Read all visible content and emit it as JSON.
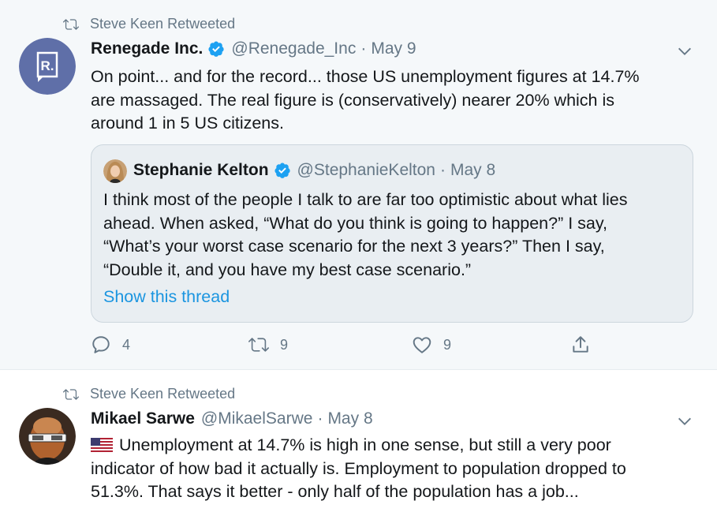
{
  "tweet1": {
    "retweet_by": "Steve Keen Retweeted",
    "author_name": "Renegade Inc.",
    "author_handle": "@Renegade_Inc",
    "date": "May 9",
    "dot": "·",
    "avatar_letter": "R.",
    "text_lines": [
      "On point... and for the record... those US unemployment figures at 14.7%",
      "are massaged. The real figure is (conservatively) nearer 20% which is",
      "around 1 in 5 US citizens."
    ],
    "quote": {
      "author_name": "Stephanie Kelton",
      "author_handle": "@StephanieKelton",
      "date": "May 8",
      "text_lines": [
        "I think most of the people I talk to are far too optimistic about what lies",
        "ahead. When asked, “What do you think is going to happen?” I say,",
        "“What’s your worst case scenario for the next 3 years?” Then I say,",
        "“Double it, and you have my best case scenario.”"
      ],
      "link": "Show this thread"
    },
    "actions": {
      "replies": "4",
      "retweets": "9",
      "likes": "9"
    }
  },
  "tweet2": {
    "retweet_by": "Steve Keen Retweeted",
    "author_name": "Mikael Sarwe",
    "author_handle": "@MikaelSarwe",
    "date": "May 8",
    "dot": "·",
    "text_lines": [
      "Unemployment at 14.7% is high in one sense, but still a very poor",
      "indicator of how bad it actually is. Employment to population dropped to",
      "51.3%. That says it better - only half of the population has a job..."
    ]
  },
  "colors": {
    "accent": "#1da1f2",
    "link": "#1b95e0",
    "muted": "#657786",
    "text": "#14171a"
  }
}
